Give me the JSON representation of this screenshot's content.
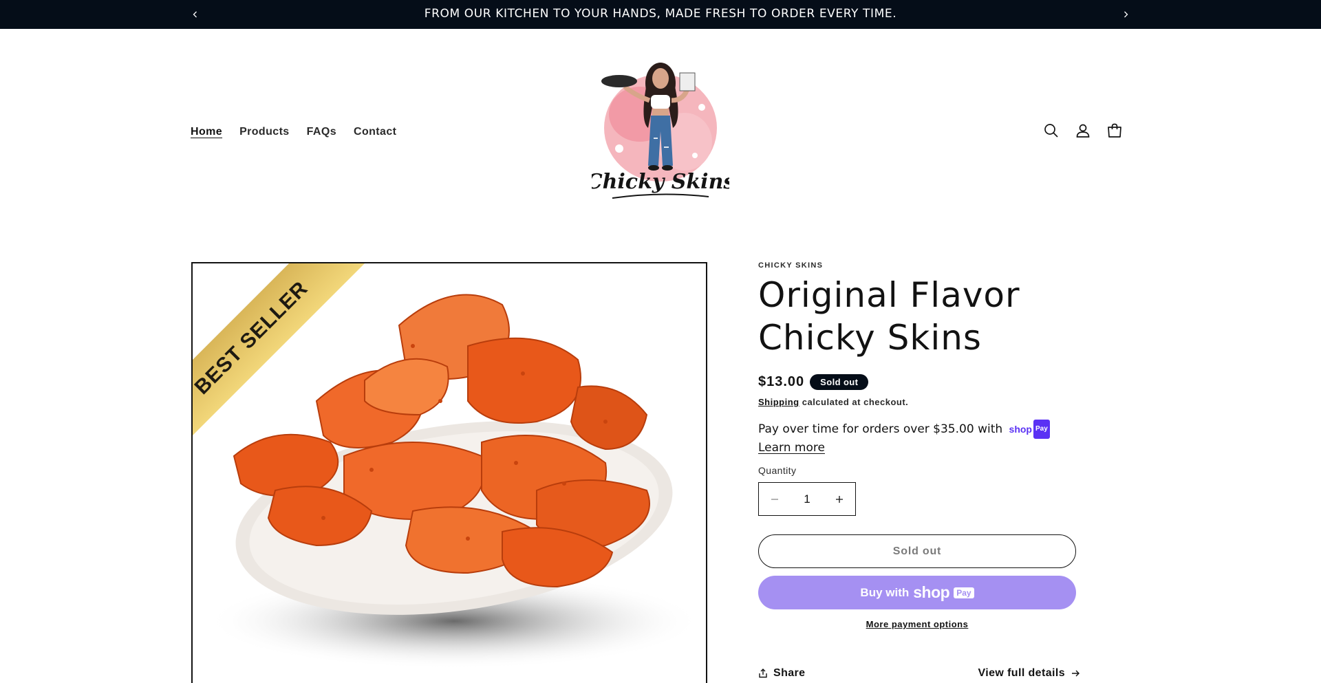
{
  "announcement": {
    "text": "FROM OUR KITCHEN TO YOUR HANDS, MADE FRESH TO ORDER EVERY TIME.",
    "prev_icon": "chevron-left-icon",
    "next_icon": "chevron-right-icon"
  },
  "header": {
    "nav": [
      {
        "label": "Home",
        "active": true
      },
      {
        "label": "Products",
        "active": false
      },
      {
        "label": "FAQs",
        "active": false
      },
      {
        "label": "Contact",
        "active": false
      }
    ],
    "logo_text": "Chicky Skins",
    "icons": [
      "search-icon",
      "account-icon",
      "cart-icon"
    ]
  },
  "product": {
    "vendor": "CHICKY SKINS",
    "title_line1": "Original Flavor",
    "title_line2": "Chicky Skins",
    "price": "$13.00",
    "badge": "Sold out",
    "shipping_link": "Shipping",
    "shipping_rest": "calculated at checkout.",
    "installments_text": "Pay over time for orders over $35.00 with",
    "shoppay_word": "shop",
    "shoppay_pay": "Pay",
    "learn_more": "Learn more",
    "quantity_label": "Quantity",
    "quantity_value": "1",
    "sold_out_button": "Sold out",
    "buy_with": "Buy with",
    "buy_shop": "shop",
    "buy_pay": "Pay",
    "more_payment": "More payment options",
    "share": "Share",
    "view_details": "View full details",
    "media_banner": "BEST SELLER"
  },
  "colors": {
    "announcement_bg": "#050d18",
    "shop_pay_button": "#a590f2",
    "shop_pay_brand": "#5a31f4",
    "banner_gold": "#d9b24c"
  }
}
